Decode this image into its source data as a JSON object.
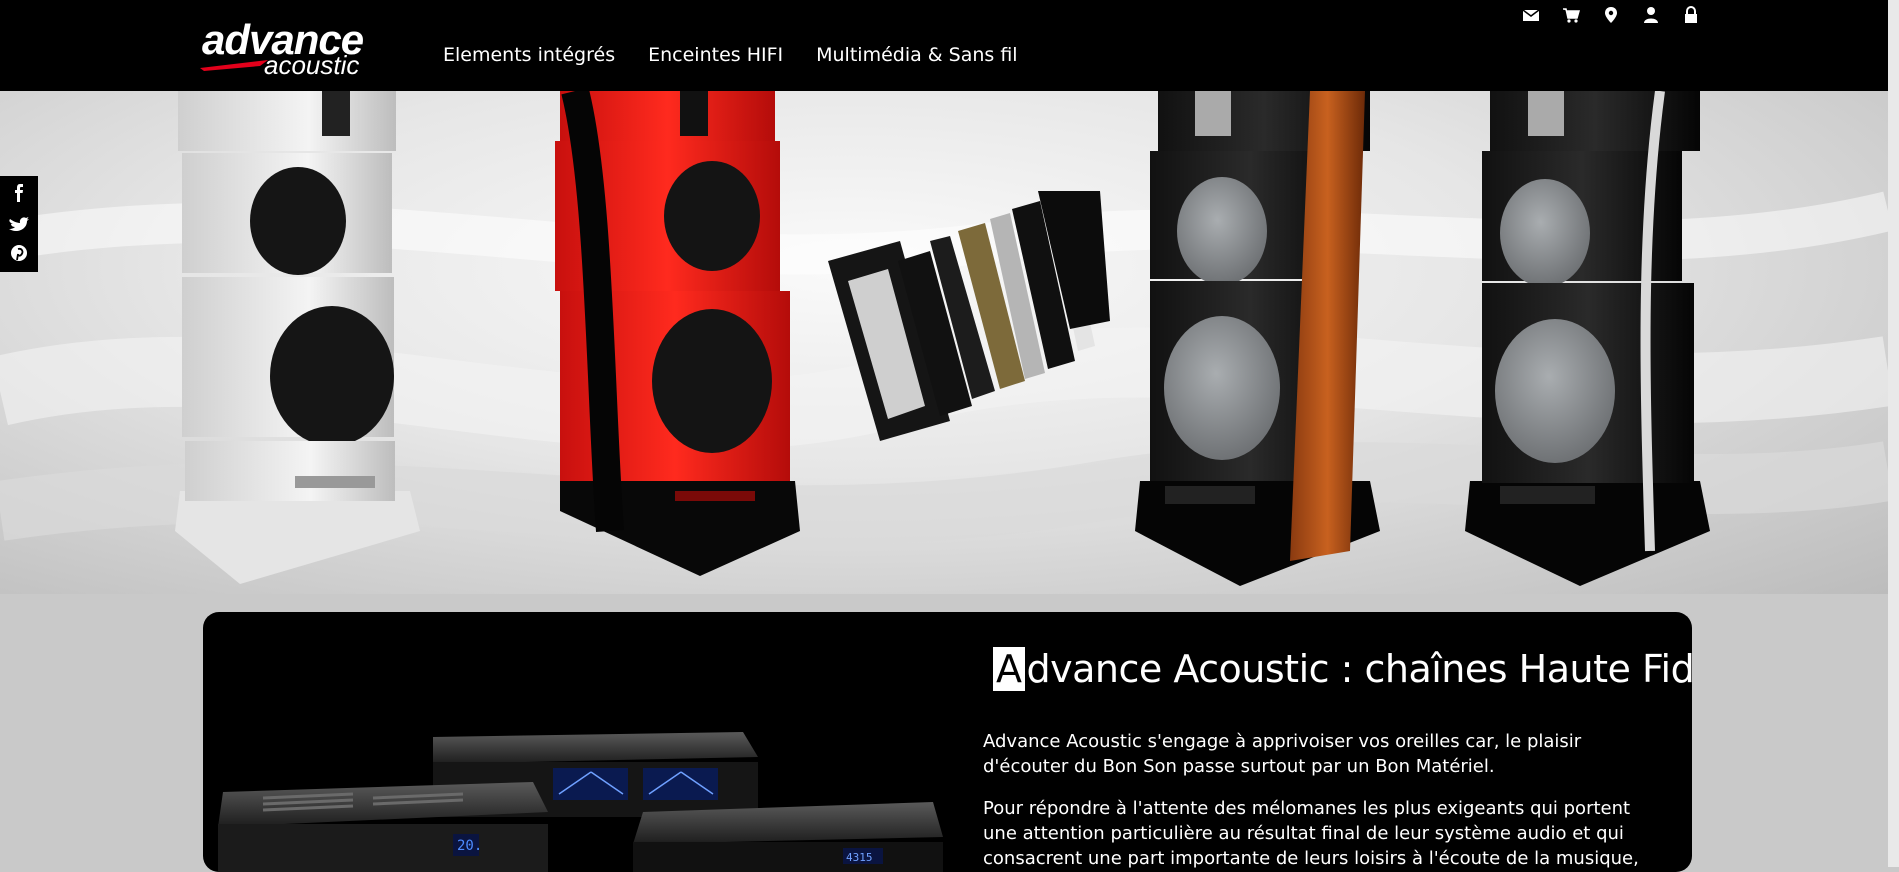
{
  "brand": {
    "line1": "advance",
    "line2": "acoustic"
  },
  "nav": [
    "Elements intégrés",
    "Enceintes HIFI",
    "Multimédia & Sans fil"
  ],
  "top_icons": [
    "envelope-icon",
    "cart-icon",
    "map-marker-icon",
    "user-icon",
    "lock-icon"
  ],
  "social": [
    "facebook-icon",
    "twitter-icon",
    "pinterest-icon"
  ],
  "intro": {
    "title_initial": "A",
    "title_rest": "dvance Acoustic : chaînes Haute Fidélité",
    "p1": "Advance Acoustic s'engage à apprivoiser vos oreilles car, le plaisir d'écouter du Bon Son passe surtout par un Bon Matériel.",
    "p2": "Pour répondre à l'attente des mélomanes les plus exigeants qui portent une attention particulière au résultat final de leur système audio et qui consacrent une part importante de leurs loisirs à l'écoute de la musique, nous avons créé des"
  },
  "colors": {
    "accent": "#e3001b",
    "header_bg": "#000000",
    "page_bg": "#c9c9c9"
  }
}
